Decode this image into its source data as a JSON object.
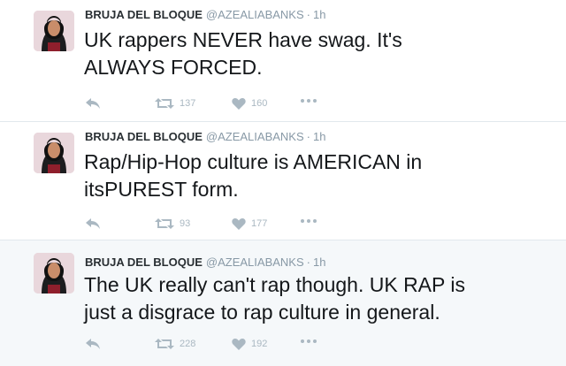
{
  "tweets": [
    {
      "name": "BRUJA DEL BLOQUE",
      "handle": "@AZEALIABANKS",
      "separator": "·",
      "time": "1h",
      "text": "UK rappers NEVER have swag. It's\nALWAYS FORCED.",
      "retweets": "137",
      "likes": "160"
    },
    {
      "name": "BRUJA DEL BLOQUE",
      "handle": "@AZEALIABANKS",
      "separator": "·",
      "time": "1h",
      "text": "Rap/Hip-Hop culture is AMERICAN in\nitsPUREST form.",
      "retweets": "93",
      "likes": "177"
    },
    {
      "name": "BRUJA DEL BLOQUE",
      "handle": "@AZEALIABANKS",
      "separator": "·",
      "time": "1h",
      "text": "The UK really can't rap though. UK RAP is\njust a disgrace to rap culture in general.",
      "retweets": "228",
      "likes": "192"
    }
  ],
  "icons": {
    "reply": "reply-icon",
    "retweet": "retweet-icon",
    "like": "heart-icon",
    "more": "more-icon"
  },
  "colors": {
    "text": "#14171a",
    "meta": "#8899a6",
    "action": "#aab8c2",
    "divider": "#e1e8ed",
    "highlight_bg": "#f5f8fa"
  }
}
